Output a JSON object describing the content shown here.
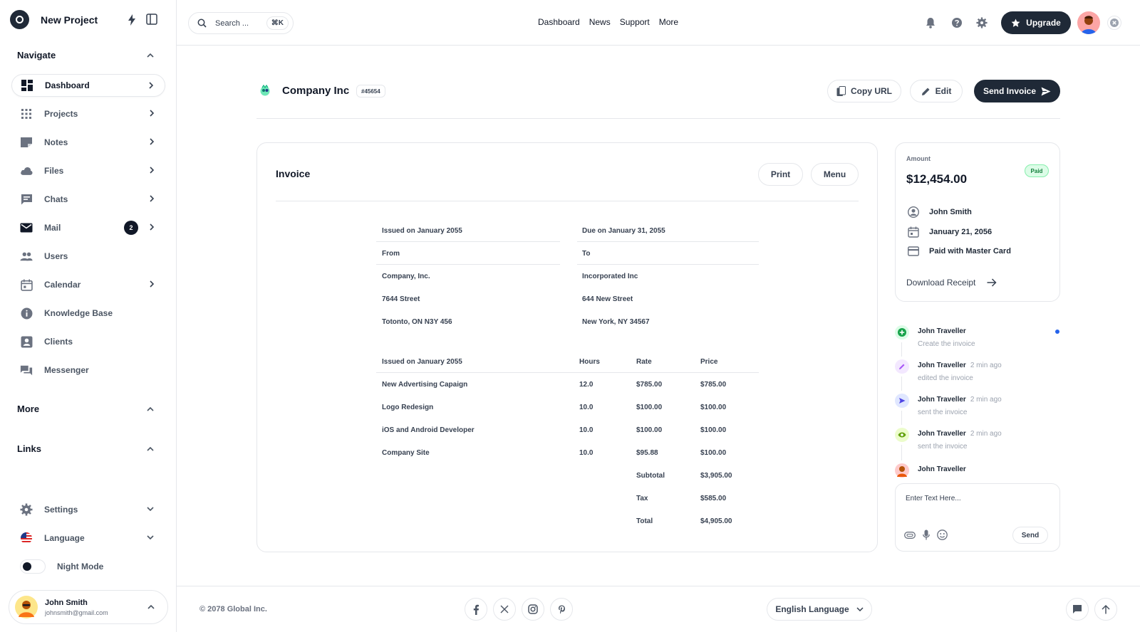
{
  "brand": {
    "title": "New Project"
  },
  "sidebar": {
    "navigate_title": "Navigate",
    "items": [
      {
        "label": "Dashboard",
        "icon": "dashboard-icon",
        "active": true,
        "chevron": true
      },
      {
        "label": "Projects",
        "icon": "grid-icon",
        "chevron": true
      },
      {
        "label": "Notes",
        "icon": "note-icon",
        "chevron": true
      },
      {
        "label": "Files",
        "icon": "cloud-icon",
        "chevron": true
      },
      {
        "label": "Chats",
        "icon": "chat-icon",
        "chevron": true
      },
      {
        "label": "Mail",
        "icon": "mail-icon",
        "badge": "2",
        "chevron": true
      },
      {
        "label": "Users",
        "icon": "users-icon",
        "chevron": false
      },
      {
        "label": "Calendar",
        "icon": "calendar-icon",
        "chevron": true
      },
      {
        "label": "Knowledge Base",
        "icon": "info-icon",
        "chevron": false
      },
      {
        "label": "Clients",
        "icon": "contact-icon",
        "chevron": false
      },
      {
        "label": "Messenger",
        "icon": "forum-icon",
        "chevron": false
      }
    ],
    "more_title": "More",
    "links_title": "Links",
    "settings_label": "Settings",
    "language_label": "Language",
    "night_mode_label": "Night Mode",
    "user": {
      "name": "John Smith",
      "email": "johnsmith@gmail.com"
    }
  },
  "topbar": {
    "search_placeholder": "Search ...",
    "shortcut": "⌘K",
    "nav": [
      "Dashboard",
      "News",
      "Support",
      "More"
    ],
    "upgrade_label": "Upgrade"
  },
  "header": {
    "company": "Company Inc",
    "id": "#45654",
    "copy_url": "Copy URL",
    "edit": "Edit",
    "send_invoice": "Send Invoice"
  },
  "invoice": {
    "title": "Invoice",
    "print": "Print",
    "menu": "Menu",
    "issued": "Issued on January 2055",
    "due": "Due on January 31, 2055",
    "from_label": "From",
    "to_label": "To",
    "from": [
      "Company, Inc.",
      "7644 Street",
      "Totonto, ON N3Y 456"
    ],
    "to": [
      "Incorporated Inc",
      "644 New Street",
      "New York, NY 34567"
    ],
    "columns": [
      "Issued on January 2055",
      "Hours",
      "Rate",
      "Price"
    ],
    "rows": [
      [
        "New Advertising Capaign",
        "12.0",
        "$785.00",
        "$785.00"
      ],
      [
        "Logo Redesign",
        "10.0",
        "$100.00",
        "$100.00"
      ],
      [
        "iOS and Android Developer",
        "10.0",
        "$100.00",
        "$100.00"
      ],
      [
        "Company Site",
        "10.0",
        "$95.88",
        "$100.00"
      ]
    ],
    "summary": [
      [
        "Subtotal",
        "$3,905.00"
      ],
      [
        "Tax",
        "$585.00"
      ],
      [
        "Total",
        "$4,905.00"
      ]
    ]
  },
  "amount": {
    "label": "Amount",
    "value": "$12,454.00",
    "status": "Paid",
    "customer": "John Smith",
    "date": "January 21, 2056",
    "method": "Paid with Master Card",
    "download": "Download Receipt"
  },
  "activity": [
    {
      "name": "John Traveller",
      "time": "",
      "action": "Create the invoice",
      "icon": "plus-icon",
      "color": "#16a34a"
    },
    {
      "name": "John Traveller",
      "time": "2 min ago",
      "action": "edited the invoice",
      "icon": "pencil-icon",
      "color": "#a855f7"
    },
    {
      "name": "John Traveller",
      "time": "2 min ago",
      "action": "sent the invoice",
      "icon": "send-icon",
      "color": "#4f46e5"
    },
    {
      "name": "John Traveller",
      "time": "2 min ago",
      "action": "sent the invoice",
      "icon": "eye-icon",
      "color": "#65a30d"
    },
    {
      "name": "John Traveller",
      "time": "",
      "action": "",
      "icon": "avatar",
      "color": "#f59e0b"
    }
  ],
  "composer": {
    "placeholder": "Enter Text Here...",
    "send": "Send"
  },
  "footer": {
    "copyright": "© 2078 Global Inc.",
    "language": "English Language"
  },
  "colors": {
    "dark": "#1f2937",
    "border": "#e5e7eb",
    "accent_blue": "#2563eb",
    "paid_green": "#15803d"
  }
}
